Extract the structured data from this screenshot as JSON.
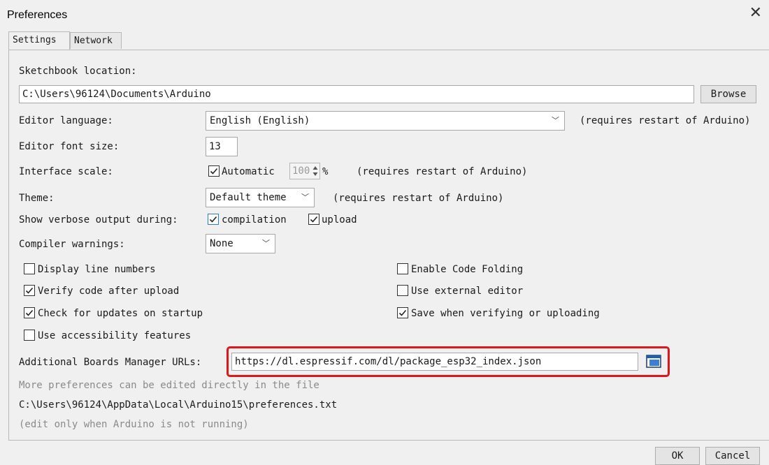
{
  "window": {
    "title": "Preferences",
    "close_glyph": "✕"
  },
  "tabs": [
    {
      "label": "Settings",
      "active": true
    },
    {
      "label": "Network",
      "active": false
    }
  ],
  "sketchbook": {
    "label": "Sketchbook location:",
    "value": "C:\\Users\\96124\\Documents\\Arduino",
    "browse": "Browse"
  },
  "editor_language": {
    "label": "Editor language:",
    "selected": "English (English)",
    "note": "(requires restart of Arduino)"
  },
  "font_size": {
    "label": "Editor font size:",
    "value": "13"
  },
  "interface_scale": {
    "label": "Interface scale:",
    "automatic_label": "Automatic",
    "automatic_checked": true,
    "value": "100",
    "unit": "%",
    "note": "(requires restart of Arduino)"
  },
  "theme": {
    "label": "Theme:",
    "selected": "Default theme",
    "note": "(requires restart of Arduino)"
  },
  "verbose": {
    "label": "Show verbose output during:",
    "compilation_label": "compilation",
    "compilation_checked": true,
    "upload_label": "upload",
    "upload_checked": true
  },
  "compiler_warnings": {
    "label": "Compiler warnings:",
    "selected": "None"
  },
  "options_left": [
    {
      "label": "Display line numbers",
      "checked": false
    },
    {
      "label": "Verify code after upload",
      "checked": true
    },
    {
      "label": "Check for updates on startup",
      "checked": true
    },
    {
      "label": "Use accessibility features",
      "checked": false
    }
  ],
  "options_right": [
    {
      "label": "Enable Code Folding",
      "checked": false
    },
    {
      "label": "Use external editor",
      "checked": false
    },
    {
      "label": "Save when verifying or uploading",
      "checked": true
    }
  ],
  "boards_manager": {
    "label": "Additional Boards Manager URLs:",
    "value": "https://dl.espressif.com/dl/package_esp32_index.json",
    "highlight_color": "#e0161a"
  },
  "footer": {
    "more_prefs": "More preferences can be edited directly in the file",
    "path": "C:\\Users\\96124\\AppData\\Local\\Arduino15\\preferences.txt",
    "edit_note": "(edit only when Arduino is not running)"
  },
  "buttons": {
    "ok": "OK",
    "cancel": "Cancel"
  },
  "colors": {
    "checkbox_blue": "#2a7dd6",
    "background": "#f0f0f0"
  },
  "icons": {
    "url_editor": "window-list-icon",
    "dropdown": "chevron-down-icon",
    "spinner": "spinner-arrows-icon"
  }
}
